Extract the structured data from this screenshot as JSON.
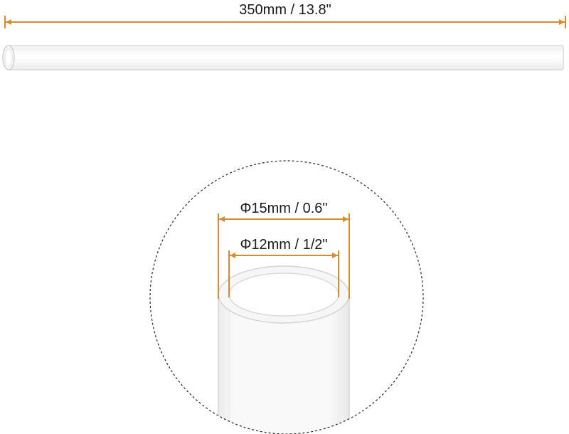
{
  "length_label": "350mm / 13.8\"",
  "outer_diameter_label": "Φ15mm / 0.6\"",
  "inner_diameter_label": "Φ12mm / 1/2\"",
  "colors": {
    "dimension_line": "#d98a2b",
    "text": "#1a1a1a",
    "tube_outline": "#d6d6d6",
    "circle_outline": "#333333"
  }
}
